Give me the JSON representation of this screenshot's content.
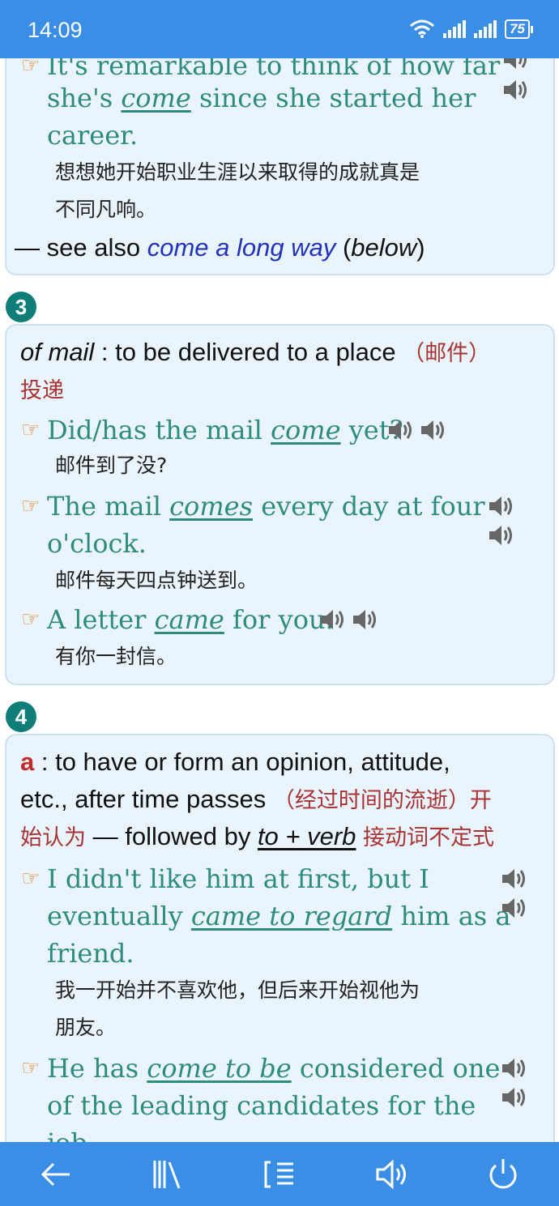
{
  "status": {
    "time": "14:09",
    "battery": "75"
  },
  "card_top": {
    "ex1_line1": "It's remarkable to think of how far",
    "ex1_line2_pre": "she's ",
    "ex1_line2_key": "come",
    "ex1_line2_post": " since she started her",
    "ex1_line3": "career.",
    "ex1_zh1": "想想她开始职业生涯以来取得的成就真是",
    "ex1_zh2": "不同凡响。",
    "see_also_dash": "— see also ",
    "see_also_link": "come a long way",
    "see_also_paren_open": " (",
    "see_also_below": "below",
    "see_also_paren_close": ")"
  },
  "sense3": {
    "number": "3",
    "def_label": "of mail",
    "def_text": " : to be delivered to a place ",
    "def_zh1": "（邮件）",
    "def_zh2": "投递",
    "examples": [
      {
        "pre": "Did/has the mail ",
        "key": "come",
        "post": " yet?",
        "zh": "邮件到了没?"
      },
      {
        "pre": "The mail ",
        "key": "comes",
        "post": " every day at four",
        "line2": "o'clock.",
        "zh": "邮件每天四点钟送到。"
      },
      {
        "pre": "A letter ",
        "key": "came",
        "post": " for you.",
        "zh": "有你一封信。"
      }
    ]
  },
  "sense4": {
    "number": "4",
    "sub": "a",
    "def_line1": " : to have or form an opinion, attitude,",
    "def_line2": "etc., after time passes ",
    "def_line2_zh": "（经过时间的流逝）开",
    "def_line3_zh_a": "始认为",
    "def_line3_mid": " — followed by ",
    "def_line3_u": "to + verb",
    "def_line3_zh_b": " 接动词不定式",
    "examples": [
      {
        "line1": "I didn't like him at first, but I",
        "pre": "eventually ",
        "key": "came to regard",
        "post": " him as a",
        "line3": "friend.",
        "zh1": "我一开始并不喜欢他，但后来开始视他为",
        "zh2": "朋友。"
      },
      {
        "pre": "He has ",
        "key": "come to be",
        "post": " considered one",
        "line2": "of the leading candidates for the",
        "line3": "job."
      }
    ]
  },
  "colors": {
    "bar": "#3a8ee6",
    "example": "#2e8b80",
    "sense_circle": "#0f7e78",
    "zh_gloss": "#a83333",
    "link": "#2233bb"
  },
  "nav": [
    "back-arrow-icon",
    "library-icon",
    "list-icon",
    "speaker-icon",
    "power-icon"
  ]
}
